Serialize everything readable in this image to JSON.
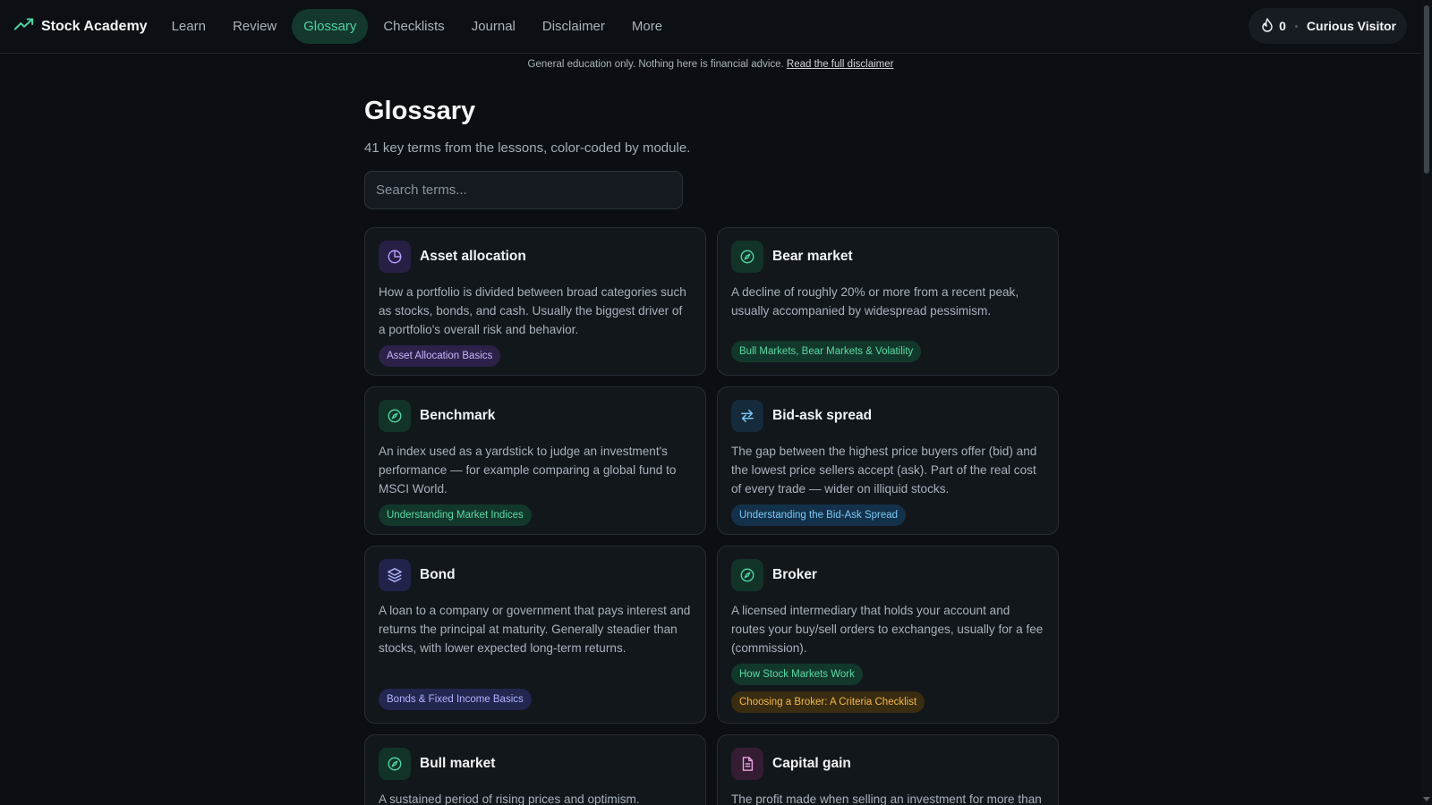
{
  "brand": {
    "name": "Stock Academy",
    "icon": "trending-up-icon"
  },
  "nav": {
    "items": [
      {
        "label": "Learn",
        "active": false
      },
      {
        "label": "Review",
        "active": false
      },
      {
        "label": "Glossary",
        "active": true
      },
      {
        "label": "Checklists",
        "active": false
      },
      {
        "label": "Journal",
        "active": false
      },
      {
        "label": "Disclaimer",
        "active": false
      },
      {
        "label": "More",
        "active": false
      }
    ]
  },
  "user": {
    "streak_icon": "flame-icon",
    "streak": "0",
    "name": "Curious Visitor"
  },
  "disclaimer": {
    "text": "General education only. Nothing here is financial advice.",
    "link": "Read the full disclaimer"
  },
  "page": {
    "title": "Glossary",
    "subtitle": "41 key terms from the lessons, color-coded by module."
  },
  "search": {
    "placeholder": "Search terms...",
    "value": ""
  },
  "colors": {
    "accent": "#4fd1a0",
    "background": "#0b0f13",
    "card": "#12171c"
  },
  "terms": [
    {
      "term": "Asset allocation",
      "icon": "pie-chart-icon",
      "definition": "How a portfolio is divided between broad categories such as stocks, bonds, and cash. Usually the biggest driver of a portfolio's overall risk and behavior.",
      "tags": [
        {
          "label": "Asset Allocation Basics",
          "color": "purple"
        }
      ]
    },
    {
      "term": "Bear market",
      "icon": "compass-icon",
      "definition": "A decline of roughly 20% or more from a recent peak, usually accompanied by widespread pessimism.",
      "tags": [
        {
          "label": "Bull Markets, Bear Markets & Volatility",
          "color": "green"
        }
      ]
    },
    {
      "term": "Benchmark",
      "icon": "compass-icon",
      "definition": "An index used as a yardstick to judge an investment's performance — for example comparing a global fund to MSCI World.",
      "tags": [
        {
          "label": "Understanding Market Indices",
          "color": "green"
        }
      ]
    },
    {
      "term": "Bid-ask spread",
      "icon": "arrows-swap-icon",
      "definition": "The gap between the highest price buyers offer (bid) and the lowest price sellers accept (ask). Part of the real cost of every trade — wider on illiquid stocks.",
      "tags": [
        {
          "label": "Understanding the Bid-Ask Spread",
          "color": "blue"
        }
      ]
    },
    {
      "term": "Bond",
      "icon": "layers-icon",
      "definition": "A loan to a company or government that pays interest and returns the principal at maturity. Generally steadier than stocks, with lower expected long-term returns.",
      "tags": [
        {
          "label": "Bonds & Fixed Income Basics",
          "color": "indigo"
        }
      ]
    },
    {
      "term": "Broker",
      "icon": "compass-icon",
      "definition": "A licensed intermediary that holds your account and routes your buy/sell orders to exchanges, usually for a fee (commission).",
      "tags": [
        {
          "label": "How Stock Markets Work",
          "color": "green"
        },
        {
          "label": "Choosing a Broker: A Criteria Checklist",
          "color": "amber"
        }
      ]
    },
    {
      "term": "Bull market",
      "icon": "compass-icon",
      "definition": "A sustained period of rising prices and optimism.",
      "tags": []
    },
    {
      "term": "Capital gain",
      "icon": "document-icon",
      "definition": "The profit made when selling an investment for more than",
      "tags": []
    }
  ]
}
